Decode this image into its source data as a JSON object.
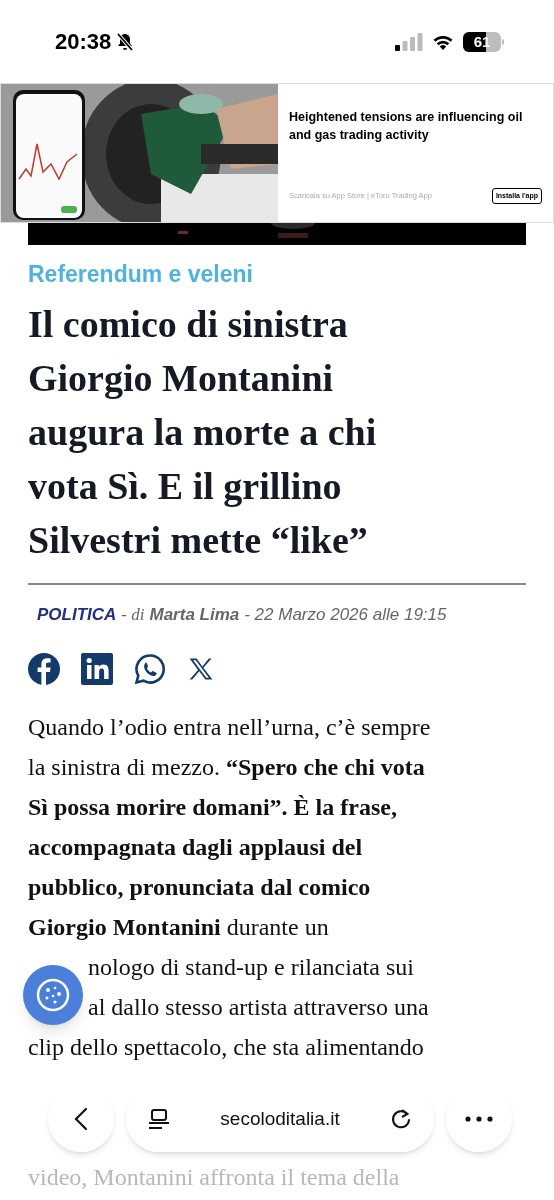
{
  "status_bar": {
    "time": "20:38",
    "battery": "61",
    "silent": true
  },
  "ad": {
    "headline": "Heightened tensions are influencing oil and gas trading activity",
    "source": "Scaricala su App Store | eToro Trading App",
    "button": "Installa l'app"
  },
  "article": {
    "category": "Referendum e veleni",
    "title": "Il comico di sinistra Giorgio Montanini augura la morte a chi vota Sì. E il grillino Silvestri mette “like”",
    "byline": {
      "section": "POLITICA",
      "by": "- di",
      "author": "Marta Lima",
      "date": "- 22 Marzo 2026 alle 19:15"
    },
    "share": [
      {
        "kind": "facebook"
      },
      {
        "kind": "linkedin"
      },
      {
        "kind": "whatsapp"
      },
      {
        "kind": "x"
      }
    ],
    "body_lines": [
      {
        "text": "Quando l’odio entra nell’urna, c’è sempre",
        "kind": "plain"
      },
      {
        "text": "la sinistra di mezzo. **“Spero che chi vota**",
        "kind": "plain"
      },
      {
        "text": "**Sì possa morire domani”. È la frase,**",
        "kind": "plain"
      },
      {
        "text": "**accompagnata dagli applausi del**",
        "kind": "plain"
      },
      {
        "text": "**pubblico, pronunciata dal comico**",
        "kind": "plain"
      },
      {
        "text": "**Giorgio Montanini** durante un",
        "kind": "plain"
      },
      {
        "text": "nologo di stand-up e rilanciata sui",
        "kind": "covered"
      },
      {
        "text": "al dallo stesso artista attraverso una",
        "kind": "covered"
      },
      {
        "text": "clip dello spettacolo, che sta alimentando",
        "kind": "plain"
      },
      {
        "text": "video, Montanini affronta il tema della",
        "kind": "faded"
      }
    ]
  },
  "browser_bar": {
    "url": "secoloditalia.it"
  }
}
